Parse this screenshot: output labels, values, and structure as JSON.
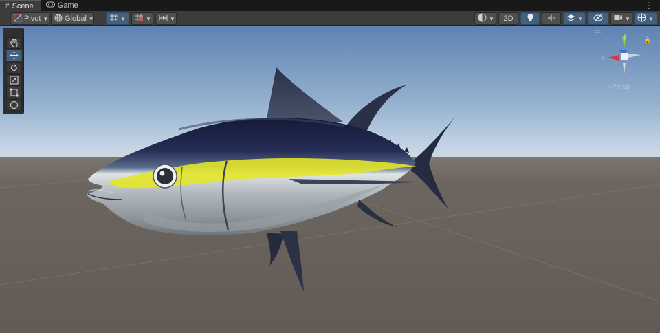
{
  "tabs": [
    {
      "label": "Scene",
      "icon": "scene-grid-icon",
      "active": true
    },
    {
      "label": "Game",
      "icon": "gamepad-icon",
      "active": false
    }
  ],
  "toolbar": {
    "pivot_label": "Pivot",
    "global_label": "Global",
    "twod_label": "2D"
  },
  "tools": [
    {
      "name": "hand-tool",
      "icon": "hand-icon",
      "active": false
    },
    {
      "name": "move-tool",
      "icon": "move-arrows-icon",
      "active": true
    },
    {
      "name": "rotate-tool",
      "icon": "rotate-icon",
      "active": false
    },
    {
      "name": "scale-tool",
      "icon": "scale-icon",
      "active": false
    },
    {
      "name": "rect-tool",
      "icon": "rect-transform-icon",
      "active": false
    },
    {
      "name": "transform-tool",
      "icon": "transform-icon",
      "active": false
    }
  ],
  "gizmo": {
    "x_label": "x",
    "y_label": "y",
    "projection_label": "Persp",
    "colors": {
      "x": "#d93a3a",
      "y": "#8ad43a",
      "z": "#3a6fd9"
    }
  },
  "scene": {
    "sky_top": "#6b8cb8",
    "sky_horizon": "#c9d8e6",
    "ground": "#6b625c",
    "fish_back": "#1c2244",
    "fish_stripe": "#e3e62a",
    "fish_belly": "#b9bfc4"
  }
}
